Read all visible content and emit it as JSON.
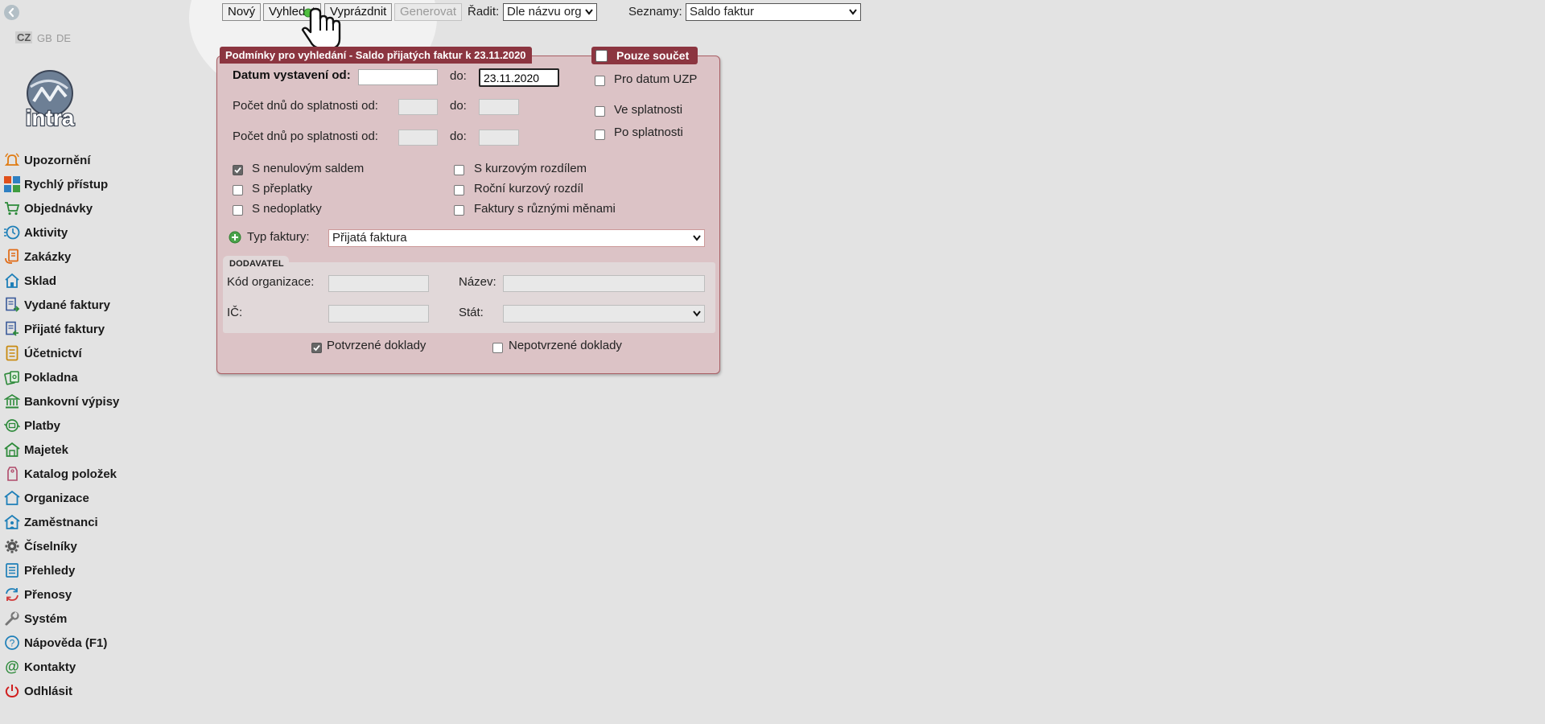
{
  "languages": [
    "CZ",
    "GB",
    "DE"
  ],
  "logo_text": "intra",
  "menu": [
    {
      "label": "Upozornění",
      "icon": "bell-icon"
    },
    {
      "label": "Rychlý přístup",
      "icon": "tiles-icon"
    },
    {
      "label": "Objednávky",
      "icon": "cart-icon"
    },
    {
      "label": "Aktivity",
      "icon": "clock-icon"
    },
    {
      "label": "Zakázky",
      "icon": "order-doc-icon"
    },
    {
      "label": "Sklad",
      "icon": "warehouse-icon"
    },
    {
      "label": "Vydané faktury",
      "icon": "invoice-out-icon"
    },
    {
      "label": "Přijaté faktury",
      "icon": "invoice-in-icon"
    },
    {
      "label": "Účetnictví",
      "icon": "ledger-icon"
    },
    {
      "label": "Pokladna",
      "icon": "cash-icon"
    },
    {
      "label": "Bankovní výpisy",
      "icon": "bank-icon"
    },
    {
      "label": "Platby",
      "icon": "payments-icon"
    },
    {
      "label": "Majetek",
      "icon": "property-icon"
    },
    {
      "label": "Katalog položek",
      "icon": "tag-icon"
    },
    {
      "label": "Organizace",
      "icon": "organization-icon"
    },
    {
      "label": "Zaměstnanci",
      "icon": "employees-icon"
    },
    {
      "label": "Číselníky",
      "icon": "gear-icon"
    },
    {
      "label": "Přehledy",
      "icon": "list-icon"
    },
    {
      "label": "Přenosy",
      "icon": "sync-icon"
    },
    {
      "label": "Systém",
      "icon": "wrench-icon"
    },
    {
      "label": "Nápověda (F1)",
      "icon": "help-icon"
    },
    {
      "label": "Kontakty",
      "icon": "at-icon"
    },
    {
      "label": "Odhlásit",
      "icon": "power-icon"
    }
  ],
  "toolbar": {
    "new": "Nový",
    "search": "Vyhledat",
    "clear": "Vyprázdnit",
    "generate": "Generovat",
    "sort_label": "Řadit:",
    "sort_value": "Dle názvu org",
    "lists_label": "Seznamy:",
    "lists_value": "Saldo faktur"
  },
  "panel": {
    "title": "Podmínky pro vyhledání - Saldo přijatých faktur k 23.11.2020",
    "sum_only": "Pouze součet",
    "date_from_label": "Datum vystavení od:",
    "date_from_value": "",
    "to_label": "do:",
    "date_to_value": "23.11.2020",
    "days_to_due_label": "Počet dnů do splatnosti od:",
    "days_after_due_label": "Počet dnů po splatnosti od:",
    "for_date_uzp": "Pro datum UZP",
    "in_due": "Ve splatnosti",
    "after_due": "Po splatnosti",
    "chk_zero_balance": "S nenulovým saldem",
    "chk_overpayments": "S přeplatky",
    "chk_underpayments": "S nedoplatky",
    "chk_fx_diff": "S kurzovým rozdílem",
    "chk_yearly_fx": "Roční kurzový rozdíl",
    "chk_multi_currency": "Faktury s různými měnami",
    "invoice_type_label": "Typ faktury:",
    "invoice_type_value": "Přijatá faktura",
    "supplier_section": "DODAVATEL",
    "org_code_label": "Kód organizace:",
    "name_label": "Název:",
    "ic_label": "IČ:",
    "country_label": "Stát:",
    "confirmed": "Potvrzené doklady",
    "unconfirmed": "Nepotvrzené doklady"
  },
  "checkbox_state": {
    "zero_balance": true,
    "confirmed": true
  }
}
